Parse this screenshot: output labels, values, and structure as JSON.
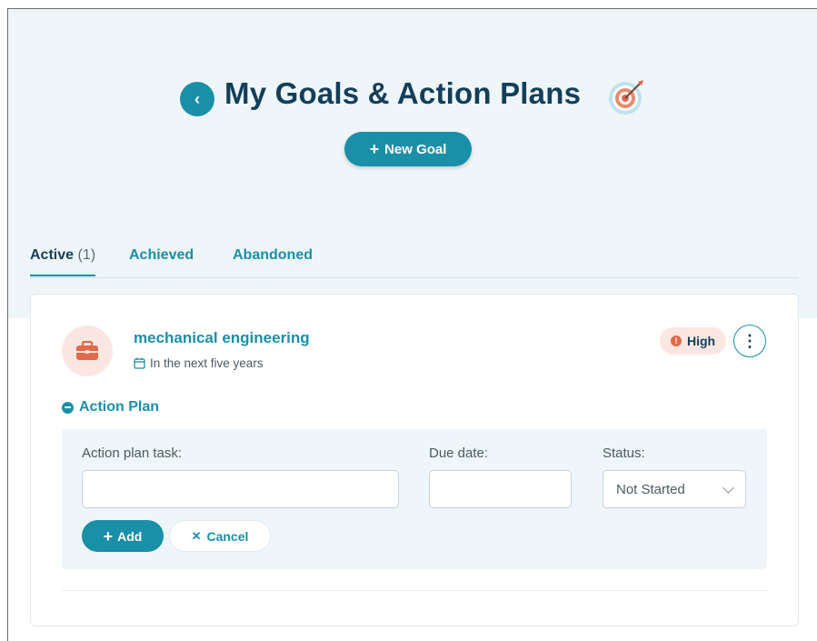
{
  "header": {
    "title": "My Goals & Action Plans",
    "back_icon": "chevron-left-icon",
    "title_icon": "target-icon"
  },
  "toolbar": {
    "new_goal_label": "New Goal"
  },
  "tabs": [
    {
      "label": "Active",
      "count": "(1)",
      "active": true
    },
    {
      "label": "Achieved",
      "count": "",
      "active": false
    },
    {
      "label": "Abandoned",
      "count": "",
      "active": false
    }
  ],
  "goal": {
    "title": "mechanical engineering",
    "timeframe": "In the next five years",
    "priority": "High",
    "category_icon": "briefcase-icon"
  },
  "action_plan": {
    "toggle_label": "Action Plan",
    "task_label": "Action plan task:",
    "task_value": "",
    "due_label": "Due date:",
    "due_value": "",
    "status_label": "Status:",
    "status_value": "Not Started",
    "add_label": "Add",
    "cancel_label": "Cancel"
  },
  "colors": {
    "accent": "#1a8fa8",
    "title_dark": "#143e59",
    "priority_bg": "#fbe7e1",
    "priority_dot": "#e06a4a",
    "hero_bg": "#eef6f9"
  }
}
